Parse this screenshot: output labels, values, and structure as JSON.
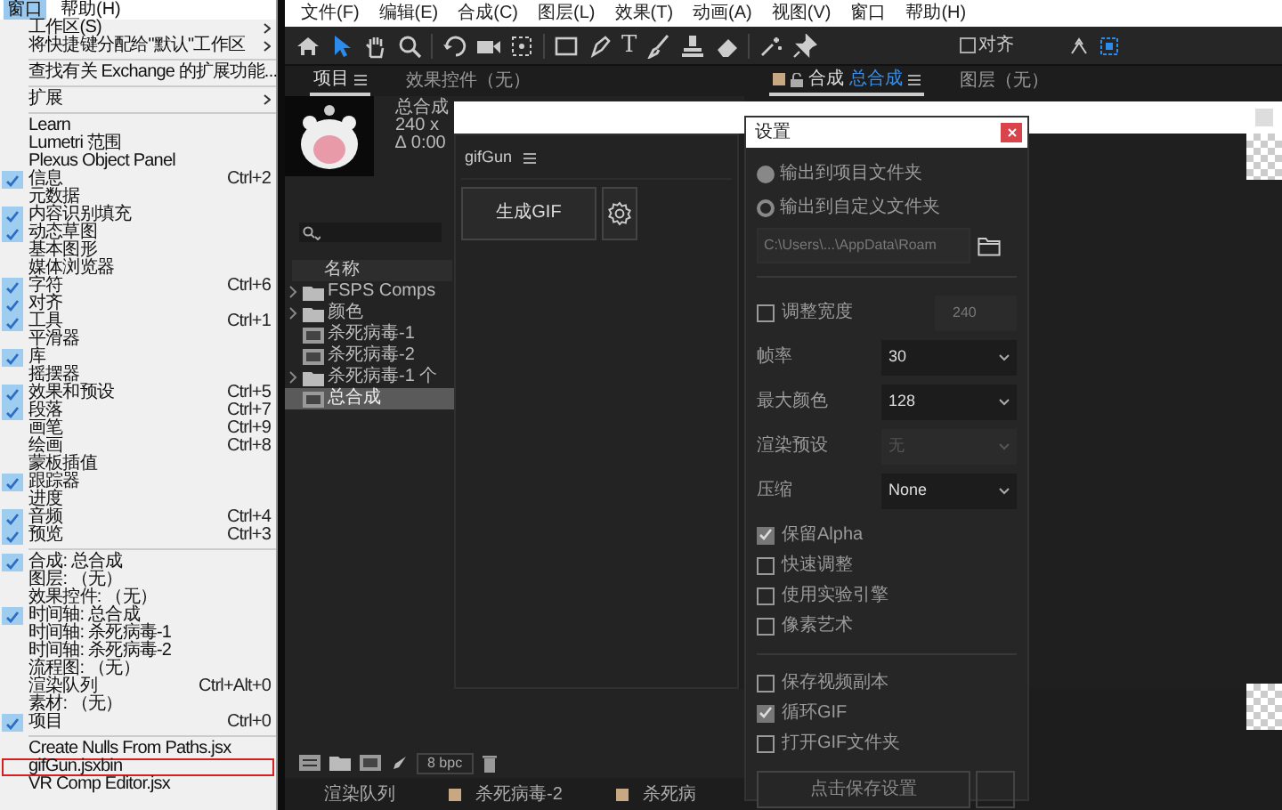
{
  "window_menu": {
    "menubar": [
      {
        "label": "窗口",
        "selected": true
      },
      {
        "label": "帮助(H)",
        "selected": false
      }
    ],
    "sections": [
      {
        "items": [
          {
            "kind": "submenu",
            "label": "工作区(S)",
            "checked": false,
            "outlined": false
          },
          {
            "kind": "submenu",
            "label": "将快捷键分配给\"默认\"工作区",
            "checked": false,
            "outlined": false
          }
        ]
      },
      {
        "items": [
          {
            "kind": "command",
            "label": "查找有关 Exchange 的扩展功能...",
            "checked": false,
            "outlined": false
          }
        ]
      },
      {
        "items": [
          {
            "kind": "submenu",
            "label": "扩展",
            "checked": false,
            "outlined": false
          }
        ]
      },
      {
        "items": [
          {
            "kind": "command",
            "label": "Learn",
            "checked": false,
            "outlined": false
          },
          {
            "kind": "command",
            "label": "Lumetri 范围",
            "checked": false,
            "outlined": false
          },
          {
            "kind": "command",
            "label": "Plexus Object Panel",
            "checked": false,
            "outlined": false
          },
          {
            "kind": "command",
            "label": "信息",
            "checked": true,
            "outlined": false,
            "shortcut": "Ctrl+2"
          },
          {
            "kind": "command",
            "label": "元数据",
            "checked": false,
            "outlined": false
          },
          {
            "kind": "command",
            "label": "内容识别填充",
            "checked": true,
            "outlined": false
          },
          {
            "kind": "command",
            "label": "动态草图",
            "checked": true,
            "outlined": false
          },
          {
            "kind": "command",
            "label": "基本图形",
            "checked": false,
            "outlined": false
          },
          {
            "kind": "command",
            "label": "媒体浏览器",
            "checked": false,
            "outlined": false
          },
          {
            "kind": "command",
            "label": "字符",
            "checked": true,
            "outlined": false,
            "shortcut": "Ctrl+6"
          },
          {
            "kind": "command",
            "label": "对齐",
            "checked": true,
            "outlined": false
          },
          {
            "kind": "command",
            "label": "工具",
            "checked": true,
            "outlined": false,
            "shortcut": "Ctrl+1"
          },
          {
            "kind": "command",
            "label": "平滑器",
            "checked": false,
            "outlined": false
          },
          {
            "kind": "command",
            "label": "库",
            "checked": true,
            "outlined": false
          },
          {
            "kind": "command",
            "label": "摇摆器",
            "checked": false,
            "outlined": false
          },
          {
            "kind": "command",
            "label": "效果和预设",
            "checked": true,
            "outlined": false,
            "shortcut": "Ctrl+5"
          },
          {
            "kind": "command",
            "label": "段落",
            "checked": true,
            "outlined": false,
            "shortcut": "Ctrl+7"
          },
          {
            "kind": "command",
            "label": "画笔",
            "checked": false,
            "outlined": false,
            "shortcut": "Ctrl+9"
          },
          {
            "kind": "command",
            "label": "绘画",
            "checked": false,
            "outlined": false,
            "shortcut": "Ctrl+8"
          },
          {
            "kind": "command",
            "label": "蒙板插值",
            "checked": false,
            "outlined": false
          },
          {
            "kind": "command",
            "label": "跟踪器",
            "checked": true,
            "outlined": false
          },
          {
            "kind": "command",
            "label": "进度",
            "checked": false,
            "outlined": false
          },
          {
            "kind": "command",
            "label": "音频",
            "checked": true,
            "outlined": false,
            "shortcut": "Ctrl+4"
          },
          {
            "kind": "command",
            "label": "预览",
            "checked": true,
            "outlined": false,
            "shortcut": "Ctrl+3"
          }
        ]
      },
      {
        "items": [
          {
            "kind": "command",
            "label": "合成: 总合成",
            "checked": true,
            "outlined": false
          },
          {
            "kind": "command",
            "label": "图层: （无）",
            "checked": false,
            "outlined": false
          },
          {
            "kind": "command",
            "label": "效果控件: （无）",
            "checked": false,
            "outlined": false
          },
          {
            "kind": "command",
            "label": "时间轴: 总合成",
            "checked": true,
            "outlined": false
          },
          {
            "kind": "command",
            "label": "时间轴: 杀死病毒-1",
            "checked": false,
            "outlined": false
          },
          {
            "kind": "command",
            "label": "时间轴: 杀死病毒-2",
            "checked": false,
            "outlined": false
          },
          {
            "kind": "command",
            "label": "流程图: （无）",
            "checked": false,
            "outlined": false
          },
          {
            "kind": "command",
            "label": "渲染队列",
            "checked": false,
            "outlined": false,
            "shortcut": "Ctrl+Alt+0"
          },
          {
            "kind": "command",
            "label": "素材: （无）",
            "checked": false,
            "outlined": false
          },
          {
            "kind": "command",
            "label": "项目",
            "checked": true,
            "outlined": false,
            "shortcut": "Ctrl+0"
          }
        ]
      },
      {
        "items": [
          {
            "kind": "command",
            "label": "Create Nulls From Paths.jsx",
            "checked": false,
            "outlined": false
          },
          {
            "kind": "command",
            "label": "gifGun.jsxbin",
            "checked": false,
            "outlined": true
          },
          {
            "kind": "command",
            "label": "VR Comp Editor.jsx",
            "checked": false,
            "outlined": false
          }
        ]
      }
    ]
  },
  "app_menubar": [
    "文件(F)",
    "编辑(E)",
    "合成(C)",
    "图层(L)",
    "效果(T)",
    "动画(A)",
    "视图(V)",
    "窗口",
    "帮助(H)"
  ],
  "toolbar": {
    "text_tool": "T",
    "snap": {
      "label": "对齐",
      "checked": false
    }
  },
  "left_tabs": [
    {
      "label": "项目",
      "selected": true
    },
    {
      "label": "效果控件（无）",
      "selected": false
    }
  ],
  "right_tabs": [
    {
      "kind": "comp",
      "prefix": "合成",
      "label": "总合成",
      "selected": true
    },
    {
      "kind": "plain",
      "label": "图层（无）",
      "selected": false
    }
  ],
  "project": {
    "info": [
      "总合成",
      "240 x",
      "∆ 0:00"
    ],
    "column": "名称",
    "rows": [
      {
        "kind": "folder",
        "label": "FSPS Comps",
        "expandable": true,
        "selected": false
      },
      {
        "kind": "folder",
        "label": "颜色",
        "expandable": true,
        "selected": false
      },
      {
        "kind": "comp",
        "label": "杀死病毒-1",
        "expandable": false,
        "selected": false
      },
      {
        "kind": "comp",
        "label": "杀死病毒-2",
        "expandable": false,
        "selected": false
      },
      {
        "kind": "folder",
        "label": "杀死病毒-1 个",
        "expandable": true,
        "selected": false
      },
      {
        "kind": "comp",
        "label": "总合成",
        "expandable": false,
        "selected": true
      }
    ],
    "bit_depth": "8 bpc"
  },
  "gifgun": {
    "title": "gifGun",
    "generate": "生成GIF"
  },
  "settings": {
    "title": "设置",
    "output": [
      {
        "label": "输出到项目文件夹",
        "selected": true
      },
      {
        "label": "输出到自定义文件夹",
        "selected": false
      }
    ],
    "path": {
      "value": "C:\\Users\\...\\AppData\\Roam",
      "disabled": true
    },
    "resize": {
      "label": "调整宽度",
      "checked": false,
      "value": "240"
    },
    "fields": [
      {
        "label": "帧率",
        "value": "30",
        "disabled": false
      },
      {
        "label": "最大颜色",
        "value": "128",
        "disabled": false
      },
      {
        "label": "渲染预设",
        "value": "无",
        "disabled": true
      },
      {
        "label": "压缩",
        "value": "None",
        "disabled": false
      }
    ],
    "options": [
      {
        "label": "保留Alpha",
        "checked": true
      },
      {
        "label": "快速调整",
        "checked": false
      },
      {
        "label": "使用实验引擎",
        "checked": false
      },
      {
        "label": "像素艺术",
        "checked": false
      }
    ],
    "outputs": [
      {
        "label": "保存视频副本",
        "checked": false
      },
      {
        "label": "循环GIF",
        "checked": true
      },
      {
        "label": "打开GIF文件夹",
        "checked": false
      }
    ],
    "save": "点击保存设置"
  },
  "bottom_tabs": [
    {
      "kind": "queue",
      "label": "渲染队列"
    },
    {
      "kind": "comp",
      "label": "杀死病毒-2"
    },
    {
      "kind": "comp",
      "label": "杀死病"
    }
  ]
}
